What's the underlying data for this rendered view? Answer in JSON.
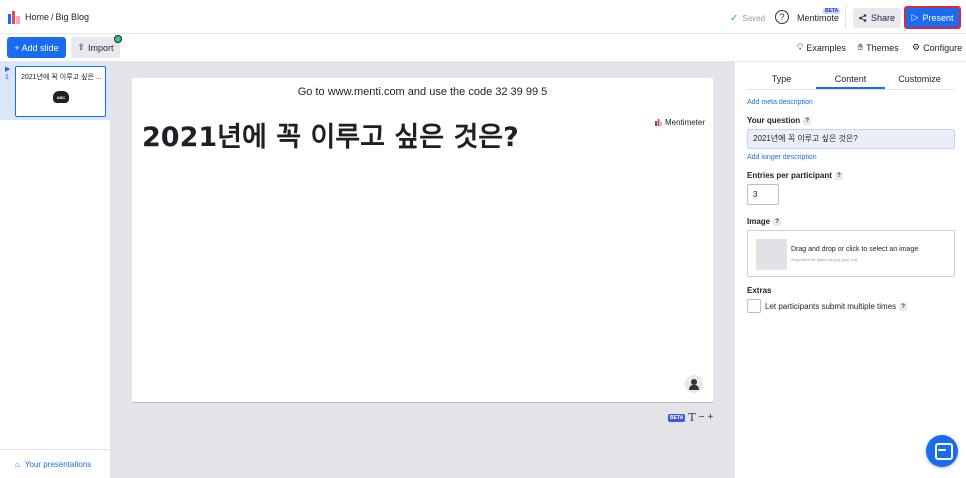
{
  "header": {
    "breadcrumb_home": "Home",
    "breadcrumb_sep": "/",
    "breadcrumb_current": "Big Blog",
    "saved_label": "Saved",
    "mentimote_label": "Mentimote",
    "mentimote_badge": "BETA",
    "share_label": "Share",
    "present_label": "Present",
    "logo_icon": "mentimeter-logo"
  },
  "toolbar": {
    "add_slide_label": "+ Add slide",
    "import_label": "Import",
    "examples_label": "Examples",
    "themes_label": "Themes",
    "configure_label": "Configure"
  },
  "sidebar": {
    "slides": [
      {
        "number": "1",
        "title": "2021년에 꼭 이루고 싶은 ...",
        "icon_text": "ABC"
      }
    ],
    "your_presentations_label": "Your presentations"
  },
  "slide": {
    "join_prefix": "Go to",
    "join_url": "www.menti.com",
    "join_middle": "and use the code",
    "join_code": "32 39 99 5",
    "brand": "Mentimeter",
    "question": "2021년에 꼭 이루고 싶은 것은?"
  },
  "canvas_tools": {
    "beta_tag": "BETA",
    "text_icon": "T",
    "minus": "−",
    "plus": "+"
  },
  "panel": {
    "tabs": [
      "Type",
      "Content",
      "Customize"
    ],
    "active_tab": "Content",
    "add_meta_description": "Add meta description",
    "your_question_label": "Your question",
    "your_question_value": "2021년에 꼭 이루고 싶은 것은?",
    "add_longer_description": "Add longer description",
    "entries_label": "Entries per participant",
    "entries_value": "3",
    "image_label": "Image",
    "image_drop_text": "Drag and drop or click to select an image",
    "image_drop_sub": "Supported file types are jpg, png, svg.",
    "extras_label": "Extras",
    "extras_option": "Let participants submit multiple times",
    "help_mark": "?"
  },
  "colors": {
    "accent": "#196cf0",
    "present_border": "#e0253a",
    "saved_check": "#2bb673",
    "canvas_bg": "#e3e3e8"
  }
}
